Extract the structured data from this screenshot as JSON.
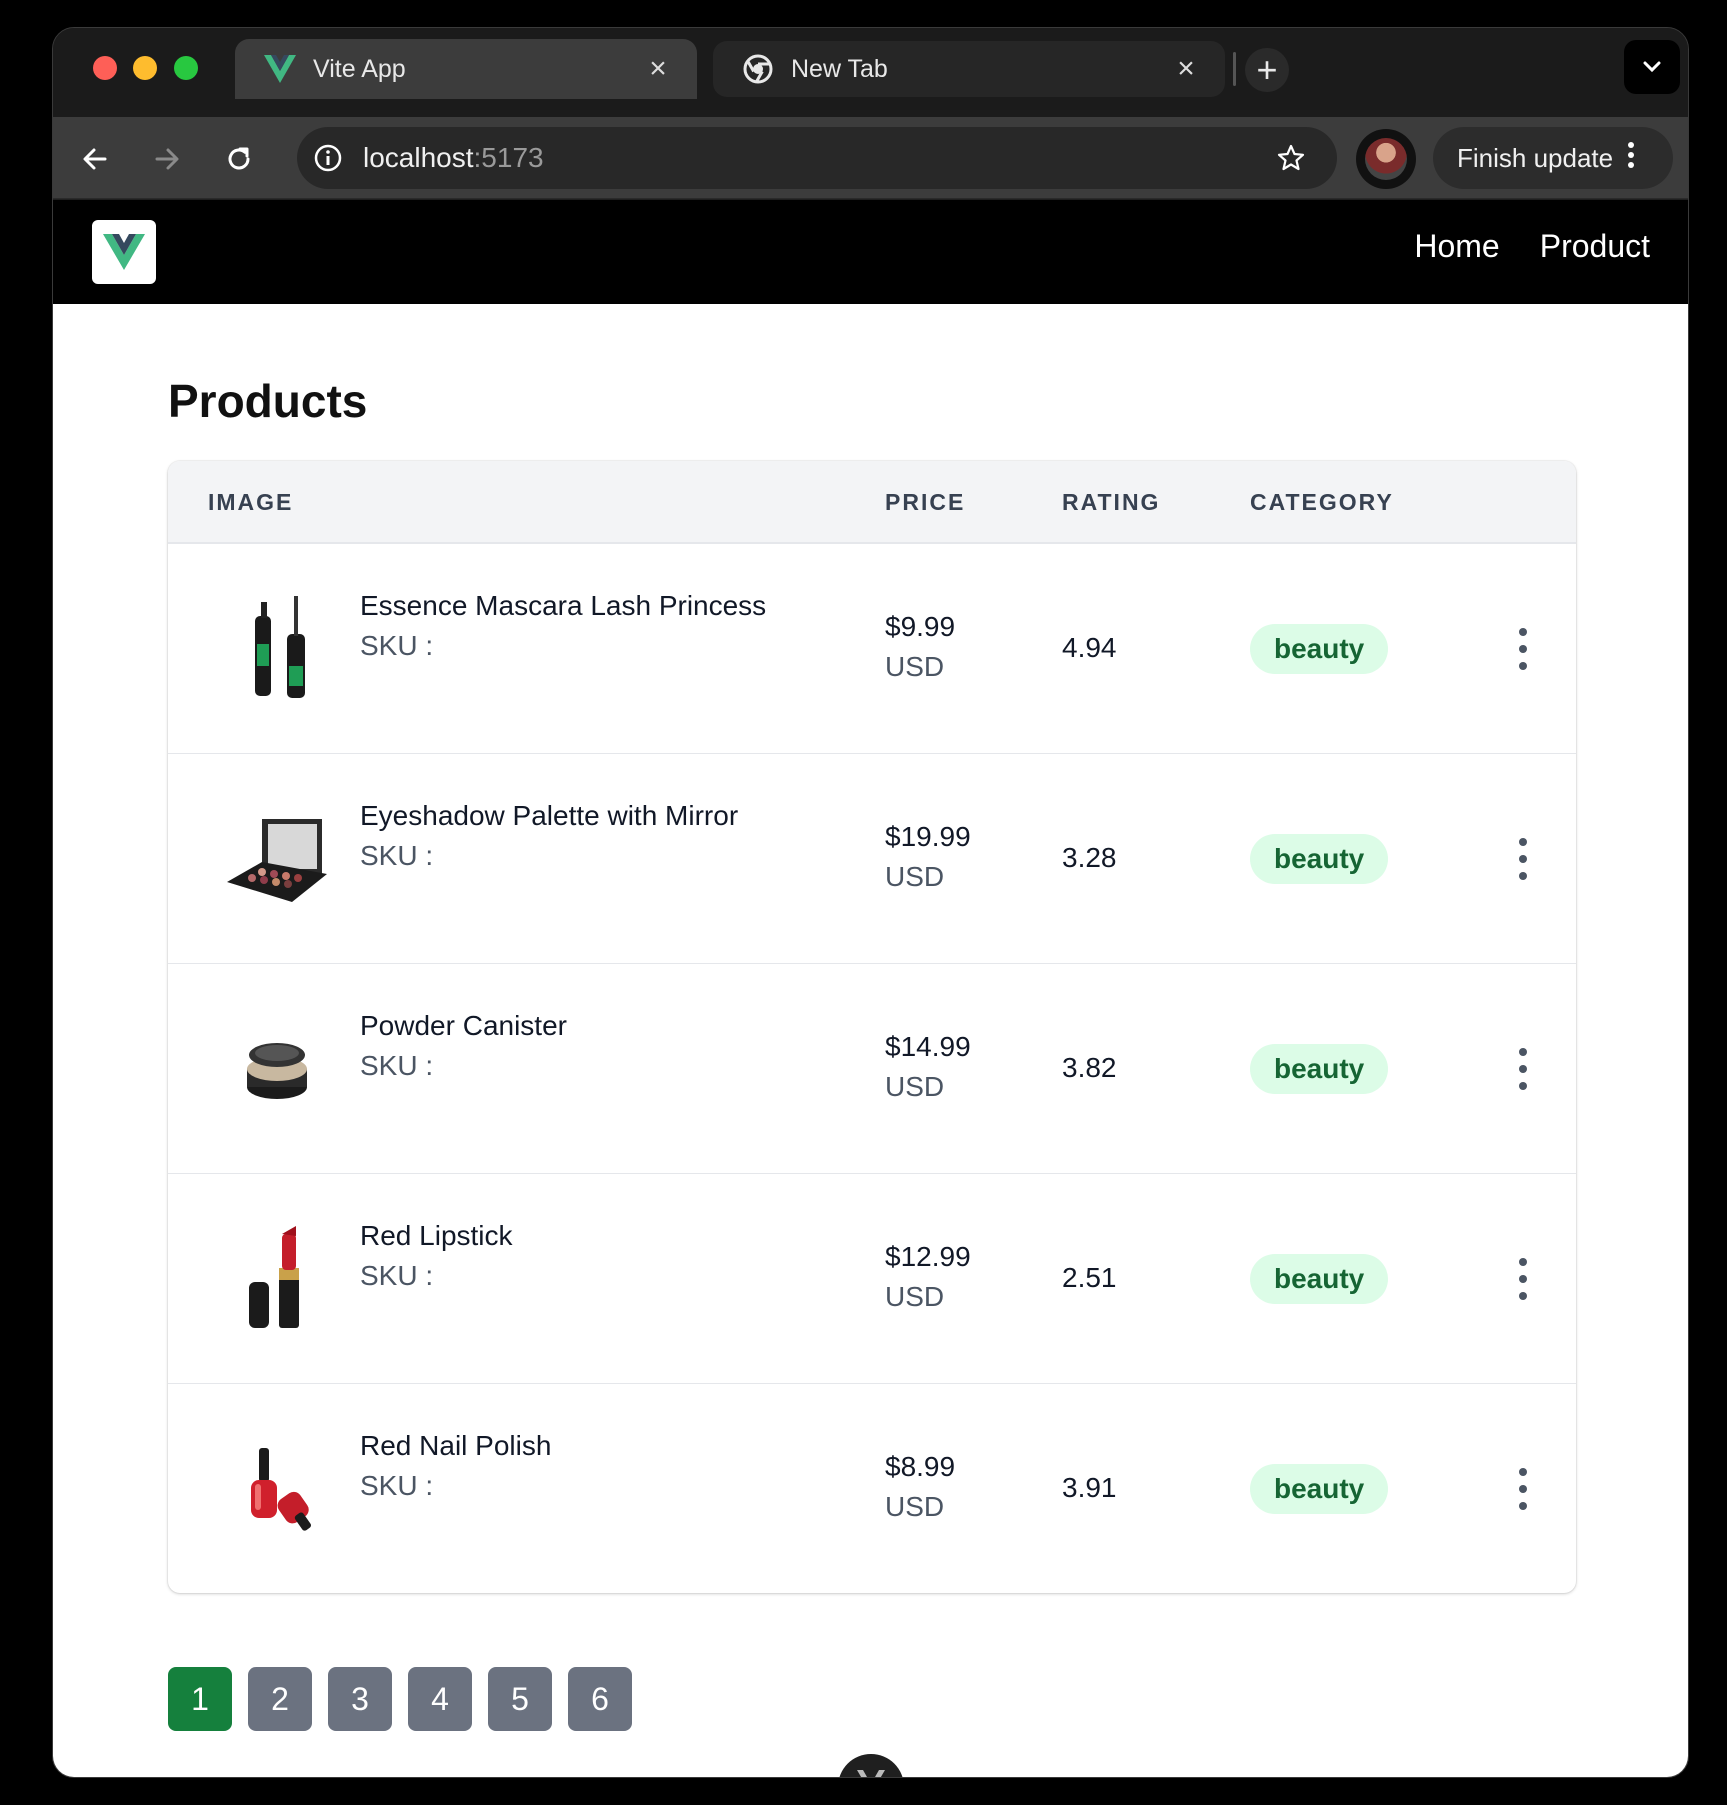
{
  "browser": {
    "tabs": [
      {
        "title": "Vite App",
        "favicon": "vue-logo-icon",
        "active": true
      },
      {
        "title": "New Tab",
        "favicon": "chrome-icon",
        "active": false
      }
    ],
    "url_host": "localhost",
    "url_port": ":5173",
    "finish_update_label": "Finish update"
  },
  "app": {
    "nav": {
      "home": "Home",
      "product": "Product"
    },
    "page_title": "Products",
    "columns": {
      "image": "IMAGE",
      "price": "PRICE",
      "rating": "RATING",
      "category": "CATEGORY"
    },
    "products": [
      {
        "name": "Essence Mascara Lash Princess",
        "sku": "SKU :",
        "price": "$9.99",
        "currency": "USD",
        "rating": "4.94",
        "category": "beauty",
        "image_icon": "mascara-icon"
      },
      {
        "name": "Eyeshadow Palette with Mirror",
        "sku": "SKU :",
        "price": "$19.99",
        "currency": "USD",
        "rating": "3.28",
        "category": "beauty",
        "image_icon": "eyeshadow-palette-icon"
      },
      {
        "name": "Powder Canister",
        "sku": "SKU :",
        "price": "$14.99",
        "currency": "USD",
        "rating": "3.82",
        "category": "beauty",
        "image_icon": "powder-canister-icon"
      },
      {
        "name": "Red Lipstick",
        "sku": "SKU :",
        "price": "$12.99",
        "currency": "USD",
        "rating": "2.51",
        "category": "beauty",
        "image_icon": "lipstick-icon"
      },
      {
        "name": "Red Nail Polish",
        "sku": "SKU :",
        "price": "$8.99",
        "currency": "USD",
        "rating": "3.91",
        "category": "beauty",
        "image_icon": "nail-polish-icon"
      }
    ],
    "pages": [
      "1",
      "2",
      "3",
      "4",
      "5",
      "6"
    ],
    "current_page": "1"
  },
  "colors": {
    "accent_green": "#15803d",
    "badge_bg": "#dcfce7",
    "badge_text": "#166534",
    "page_button": "#6b7280"
  }
}
